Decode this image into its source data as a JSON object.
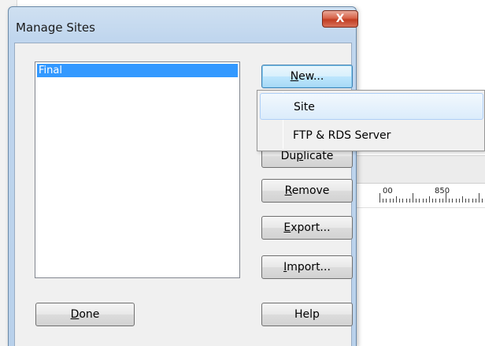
{
  "dialog": {
    "title": "Manage Sites",
    "close_label": "X"
  },
  "sites": {
    "items": [
      "Final"
    ],
    "selected": "Final"
  },
  "buttons": {
    "new": {
      "pre": "",
      "ul": "N",
      "post": "ew..."
    },
    "duplicate": {
      "pre": "Du",
      "ul": "p",
      "post": "licate"
    },
    "remove": {
      "pre": "",
      "ul": "R",
      "post": "emove"
    },
    "export": {
      "pre": "",
      "ul": "E",
      "post": "xport..."
    },
    "import": {
      "pre": "",
      "ul": "I",
      "post": "mport..."
    },
    "done": {
      "pre": "",
      "ul": "D",
      "post": "one"
    },
    "help": "Help"
  },
  "new_menu": {
    "items": [
      "Site",
      "FTP & RDS Server"
    ],
    "hovered": "Site"
  },
  "background": {
    "ruler_labels": [
      "00",
      "850"
    ]
  }
}
